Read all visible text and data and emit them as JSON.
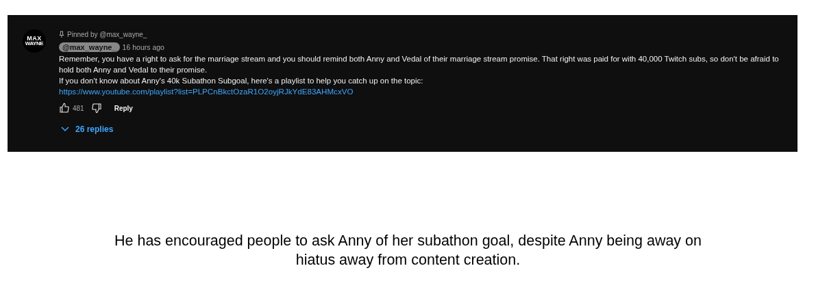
{
  "comment": {
    "avatar": {
      "line_1": "MAX",
      "line_2": "WAYNE"
    },
    "pinned": "Pinned by @max_wayne_",
    "author": "@max_wayne_",
    "author_is_owner": true,
    "time": "16 hours ago",
    "paragraphs": [
      "Remember, you have a right to ask for the marriage stream and you should remind both Anny and Vedal of their marriage stream promise. That right was paid for with 40,000 Twitch subs, so don't be afraid to hold both Anny and Vedal to their promise.",
      "If you don't know about Anny's 40k Subathon Subgoal, here's a playlist to help you catch up on the topic:"
    ],
    "link": "https://www.youtube.com/playlist?list=PLPCnBkctOzaR1O2oyjRJkYdE83AHMcxVO",
    "likes": "481",
    "reply_button": "Reply",
    "replies": "26 replies"
  },
  "caption": "He has encouraged people to ask Anny of her subathon goal, despite Anny being away on hiatus away from content creation."
}
